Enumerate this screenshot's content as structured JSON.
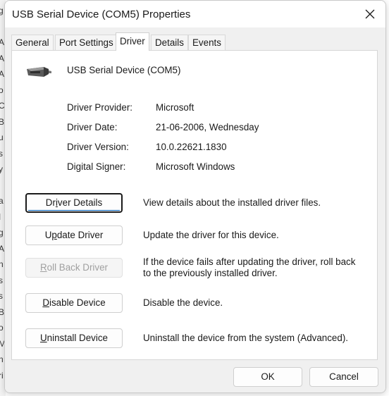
{
  "background_window": {
    "fragments": [
      "g",
      "i",
      "A",
      "A",
      "A",
      "o",
      "C",
      "B",
      "u",
      "s",
      "y",
      "i",
      "a",
      "ا",
      "g",
      "A",
      "n",
      "s",
      "s",
      "B",
      "o",
      "M",
      "n",
      "ri"
    ]
  },
  "window": {
    "title": "USB Serial Device (COM5) Properties",
    "close_icon": "close-icon"
  },
  "tabs": [
    {
      "label": "General"
    },
    {
      "label": "Port Settings"
    },
    {
      "label": "Driver",
      "active": true
    },
    {
      "label": "Details"
    },
    {
      "label": "Events"
    }
  ],
  "device": {
    "name": "USB Serial Device (COM5)",
    "icon": "serial-connector-icon"
  },
  "info": {
    "provider_label": "Driver Provider:",
    "provider_value": "Microsoft",
    "date_label": "Driver Date:",
    "date_value": "21-06-2006, Wednesday",
    "version_label": "Driver Version:",
    "version_value": "10.0.22621.1830",
    "signer_label": "Digital Signer:",
    "signer_value": "Microsoft Windows"
  },
  "actions": {
    "details_pre": "Dr",
    "details_key": "i",
    "details_post": "ver Details",
    "details_desc": "View details about the installed driver files.",
    "update_pre": "U",
    "update_key": "p",
    "update_post": "date Driver",
    "update_desc": "Update the driver for this device.",
    "rollback_pre": "",
    "rollback_key": "R",
    "rollback_post": "oll Back Driver",
    "rollback_desc": "If the device fails after updating the driver, roll back to the previously installed driver.",
    "disable_pre": "",
    "disable_key": "D",
    "disable_post": "isable Device",
    "disable_desc": "Disable the device.",
    "uninstall_pre": "",
    "uninstall_key": "U",
    "uninstall_post": "ninstall Device",
    "uninstall_desc": "Uninstall the device from the system (Advanced)."
  },
  "footer": {
    "ok_label": "OK",
    "cancel_label": "Cancel"
  }
}
